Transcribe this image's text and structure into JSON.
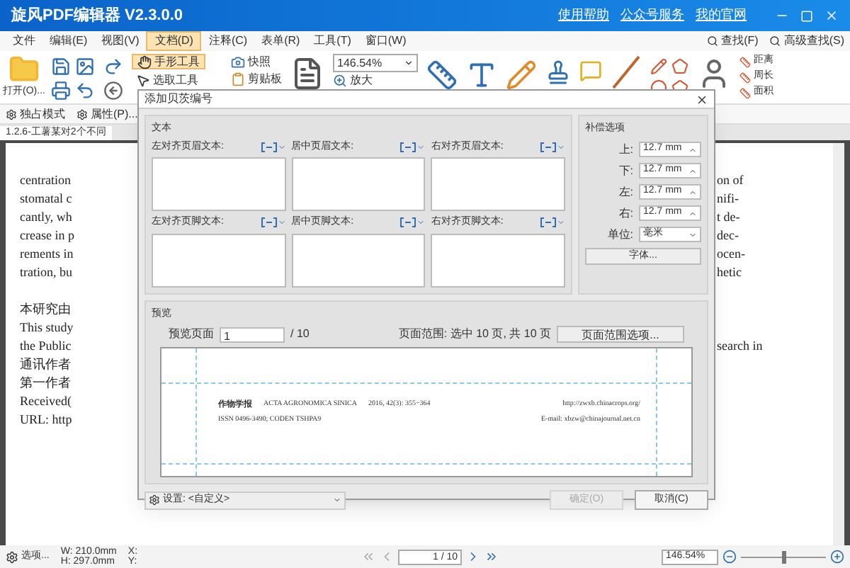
{
  "window": {
    "title": "旋风PDF编辑器 V2.3.0.0",
    "links": [
      "使用帮助",
      "公众号服务",
      "我的官网"
    ]
  },
  "menu": [
    {
      "label": "文件",
      "selected": false
    },
    {
      "label": "编辑(E)",
      "selected": false
    },
    {
      "label": "视图(V)",
      "selected": false
    },
    {
      "label": "文档(D)",
      "selected": true
    },
    {
      "label": "注释(C)",
      "selected": false
    },
    {
      "label": "表单(R)",
      "selected": false
    },
    {
      "label": "工具(T)",
      "selected": false
    },
    {
      "label": "窗口(W)",
      "selected": false
    }
  ],
  "search_buttons": [
    "查找(F)",
    "高级查找(S)"
  ],
  "toolbar": {
    "open": "打开(O)...",
    "tools": [
      {
        "label": "手形工具",
        "selected": true
      },
      {
        "label": "选取工具",
        "selected": false
      }
    ],
    "snapshot": "快照",
    "clipboard": "剪贴板",
    "zoom": "146.54%",
    "zoom_in": "放大",
    "measure": [
      {
        "label": "距离"
      },
      {
        "label": "周长"
      },
      {
        "label": "面积"
      }
    ]
  },
  "subbar": [
    "独占模式",
    "属性(P)..."
  ],
  "doc_tab": "1.2.6-工薯某对2个不同",
  "document": {
    "left_blocks": [
      [
        "centration",
        "stomatal c",
        "cantly, wh",
        "crease in p",
        "rements in",
        "tration, bu"
      ],
      [
        "本研究由",
        "This study",
        "the Public",
        "通讯作者",
        "第一作者",
        "Received(",
        "URL: http"
      ]
    ],
    "right_blocks": [
      [
        "on of",
        "nifi-",
        "t de-",
        "dec-",
        "ocen-",
        "hetic"
      ],
      [
        "search in"
      ]
    ]
  },
  "dialog": {
    "title": "添加贝茨编号",
    "text_section": {
      "title": "文本",
      "fields": [
        {
          "label": "左对齐页眉文本:"
        },
        {
          "label": "居中页眉文本:"
        },
        {
          "label": "右对齐页眉文本:"
        },
        {
          "label": "左对齐页脚文本:"
        },
        {
          "label": "居中页脚文本:"
        },
        {
          "label": "右对齐页脚文本:"
        }
      ]
    },
    "margins": {
      "title": "补偿选项",
      "rows": [
        {
          "label": "上:",
          "value": "12.7 mm"
        },
        {
          "label": "下:",
          "value": "12.7 mm"
        },
        {
          "label": "左:",
          "value": "12.7 mm"
        },
        {
          "label": "右:",
          "value": "12.7 mm"
        }
      ],
      "unit_label": "单位:",
      "unit": "毫米",
      "font_button": "字体..."
    },
    "preview": {
      "title": "预览",
      "page_label": "预览页面",
      "page": "1",
      "total": "/ 10",
      "range": "页面范围: 选中 10 页, 共 10 页",
      "range_button": "页面范围选项...",
      "header_lines": [
        {
          "left": [
            "作物学报",
            "ACTA AGRONOMICA SINICA",
            "2016, 42(3): 355−364"
          ],
          "right": "http://zwxb.chinacrops.org/"
        },
        {
          "left": [
            "ISSN 0496-3490; CODEN TSHPA9"
          ],
          "right": "E-mail: xbzw@chinajournal.net.cn"
        }
      ]
    },
    "settings": "设置: <自定义>",
    "buttons": [
      {
        "label": "确定(O)",
        "disabled": true
      },
      {
        "label": "取消(C)",
        "disabled": false
      }
    ]
  },
  "status_bar": {
    "options": "选项...",
    "size": [
      "W: 210.0mm",
      "H: 297.0mm"
    ],
    "coords": [
      "X:",
      "Y:"
    ],
    "page": "1 / 10",
    "zoom": "146.54%",
    "zoom_slider": {
      "level": 0.5
    }
  }
}
